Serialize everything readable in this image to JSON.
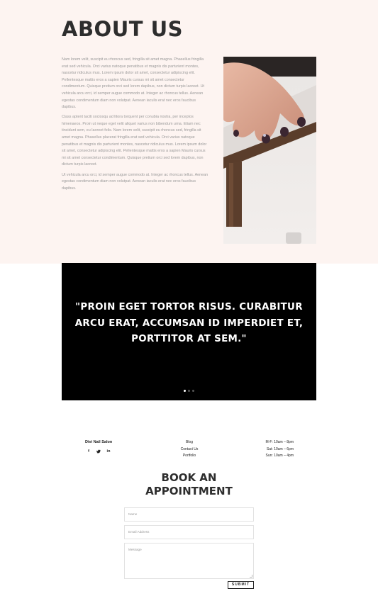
{
  "about": {
    "title": "ABOUT US",
    "paragraphs": [
      "Nam lorem velit, suscipit eu rhoncus sed, fringilla sit amet magna. Phasellus fringilla erat sed vehicula. Orci varius natoque penatibus et magnis dis parturient montes, nascetur ridiculus mus. Lorem ipsum dolor sit amet, consectetur adipiscing elit. Pellentesque mattis eros a sapien Mauris cursus mi sit amet consectetur condimentum. Quisque pretium orci sed lorem dapibus, non dictum turpis laoreet. Ut vehicula arcu orci, id semper augue commodo at. Integer ac rhoncus tellus. Aenean egestas condimentum diam non volutpat. Aenean iaculis erat nec eros faucibus dapibus.",
      "Class aptent taciti sociosqu ad litora torquent per conubia nostra, per inceptos himenaeos. Proin ut neque eget velit aliquet varius non bibendum urna. Etiam nec tincidunt sem, eu laoreet felis. Nam lorem velit, suscipit eu rhoncus sed, fringilla sit amet magna. Phasellus placerat fringilla erat sed vehicula. Orci varius natoque penatibus et magnis dis parturient montes, nascetur ridiculus mus. Lorem ipsum dolor sit amet, consectetur adipiscing elit. Pellentesque mattis eros a sapien Mauris cursus mi sit amet consectetur condimentum. Quisque pretium orci sed lorem dapibus, non dictum turpis laoreet.",
      "Ut vehicula arcu orci, id semper augue commodo at. Integer ac rhoncus tellus. Aenean egestas condimentum diam non volutpat. Aenean iaculis erat nec eros faucibus dapibus."
    ],
    "image_icon": "manicure-photo"
  },
  "quote": {
    "text": "\"PROIN EGET TORTOR RISUS. CURABITUR ARCU ERAT, ACCUMSAN ID IMPERDIET ET, PORTTITOR AT SEM.\"",
    "slide_count": 3,
    "active_slide": 1
  },
  "footer": {
    "brand": "Divi Nail Salon",
    "socials": [
      {
        "icon": "facebook-icon",
        "glyph": "f"
      },
      {
        "icon": "twitter-icon",
        "glyph": "y"
      },
      {
        "icon": "linkedin-icon",
        "glyph": "in"
      }
    ],
    "links": [
      "Blog",
      "Contact Us",
      "Portfolio"
    ],
    "hours": [
      "M-F: 10am – 8pm",
      "Sat: 10am – 6pm",
      "Sun: 10am – 4pm"
    ]
  },
  "booking": {
    "title_line1": "BOOK AN",
    "title_line2": "APPOINTMENT",
    "name_placeholder": "Name",
    "email_placeholder": "Email Address",
    "message_placeholder": "Message",
    "submit_label": "SUBMIT"
  },
  "colors": {
    "about_bg": "#fdf4f1",
    "quote_bg": "#000000",
    "heading": "#2d2d2d"
  }
}
